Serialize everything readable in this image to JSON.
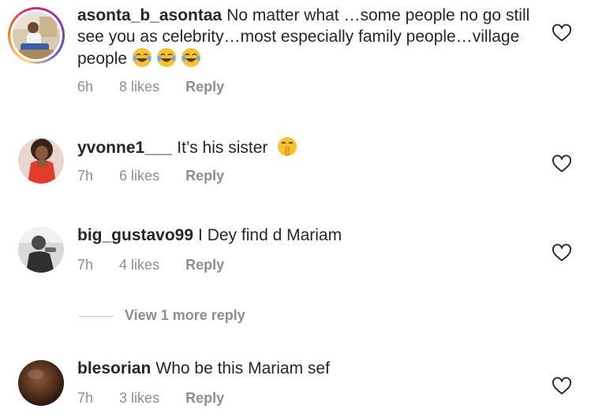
{
  "comments": [
    {
      "username": "asonta_b_asontaa",
      "text": "No matter what …some people no go still see you as celebrity…most especially family people…village people",
      "emoji": [
        "joy-emoji",
        "joy-emoji",
        "joy-emoji"
      ],
      "time": "6h",
      "likes": "8 likes",
      "reply": "Reply",
      "has_story_ring": true
    },
    {
      "username": "yvonne1___",
      "text": "It’s his sister",
      "emoji": [
        "shushing-emoji"
      ],
      "time": "7h",
      "likes": "6 likes",
      "reply": "Reply"
    },
    {
      "username": "big_gustavo99",
      "text": "I Dey find d Mariam",
      "time": "7h",
      "likes": "4 likes",
      "reply": "Reply"
    },
    {
      "username": "blesorian",
      "text": "Who be this Mariam sef",
      "time": "7h",
      "likes": "3 likes",
      "reply": "Reply"
    }
  ],
  "view_more_replies": "View 1 more reply",
  "colors": {
    "text": "#262626",
    "muted": "#8e8e8e",
    "divider": "#c7c7c7"
  }
}
